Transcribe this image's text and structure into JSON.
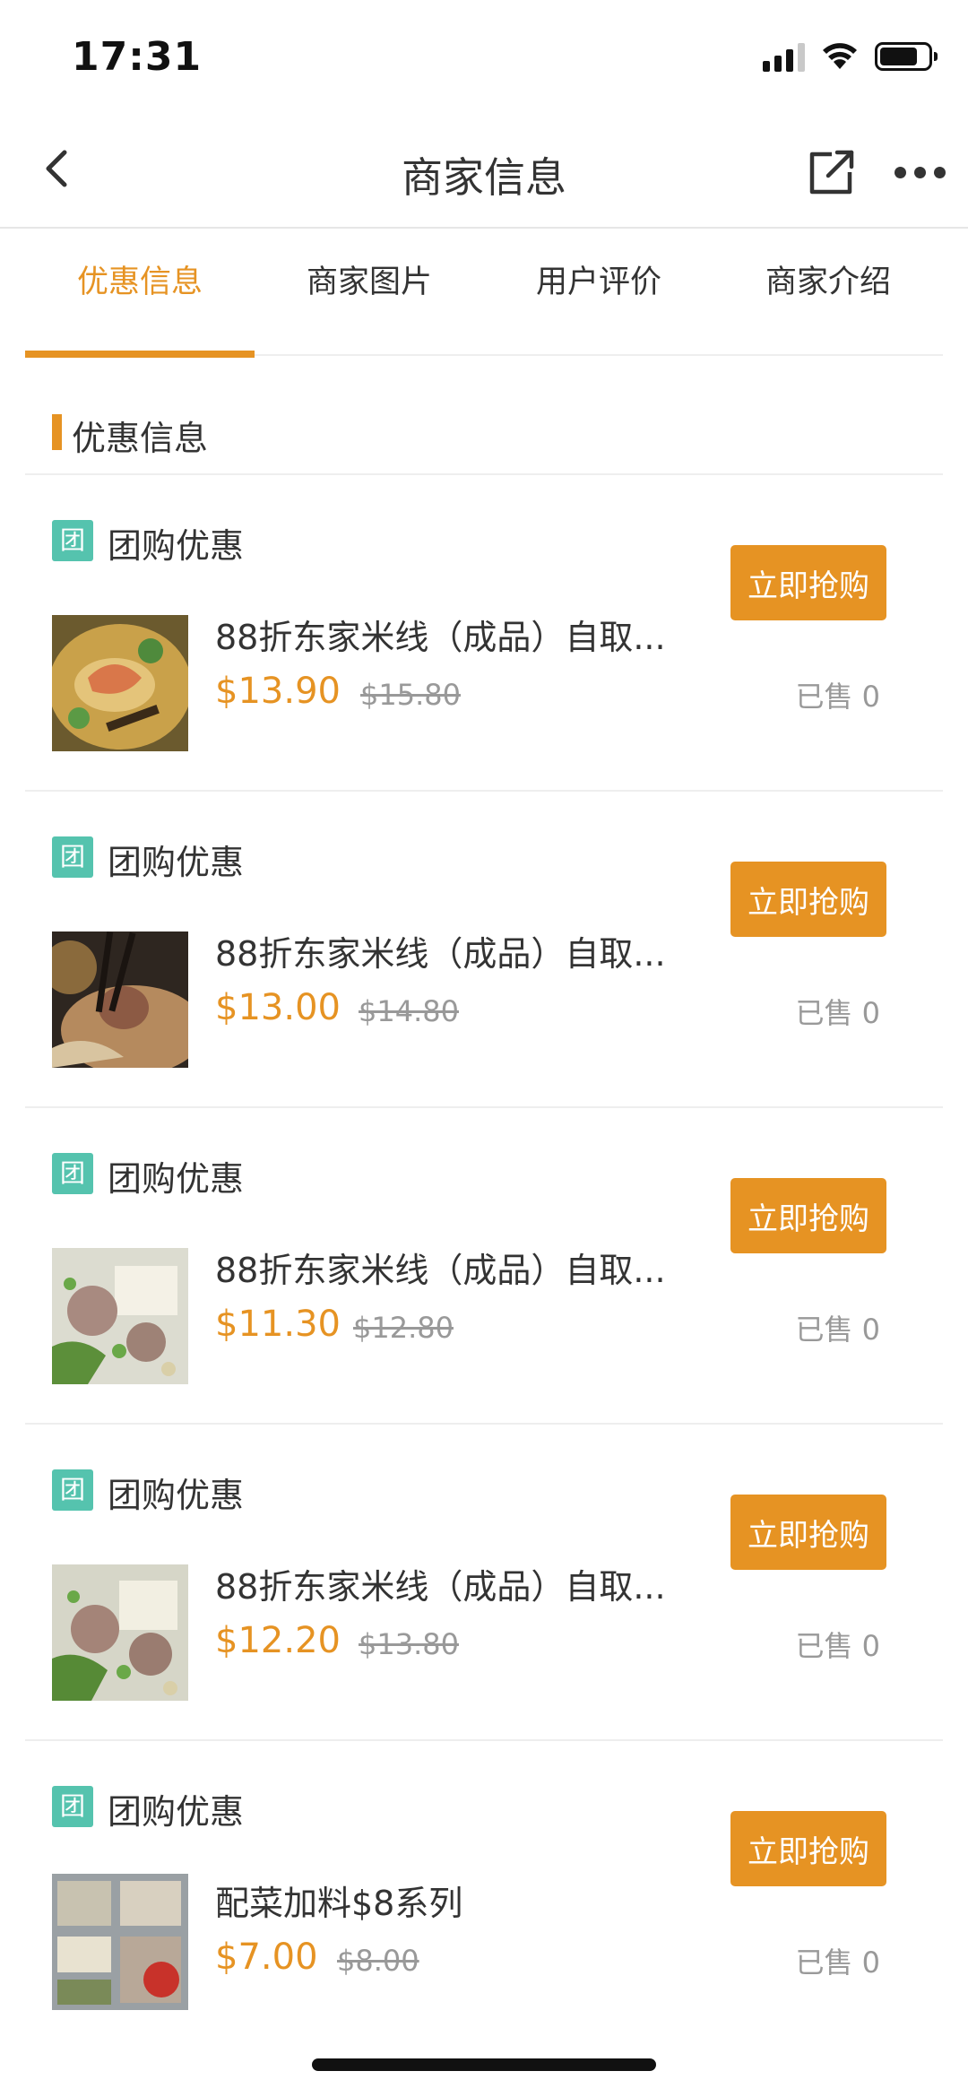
{
  "status_bar": {
    "time": "17:31"
  },
  "nav": {
    "title": "商家信息"
  },
  "tabs": [
    {
      "label": "优惠信息",
      "active": true
    },
    {
      "label": "商家图片",
      "active": false
    },
    {
      "label": "用户评价",
      "active": false
    },
    {
      "label": "商家介绍",
      "active": false
    }
  ],
  "section": {
    "title": "优惠信息"
  },
  "deals": [
    {
      "tag_icon": "团",
      "tag_label": "团购优惠",
      "name": "88折东家米线（成品）自取...",
      "price": "$13.90",
      "original_price": "$15.80",
      "buy_label": "立即抢购",
      "sold": "已售 0",
      "image": "food-photo-shrimp-hotpot"
    },
    {
      "tag_icon": "团",
      "tag_label": "团购优惠",
      "name": "88折东家米线（成品）自取...",
      "price": "$13.00",
      "original_price": "$14.80",
      "buy_label": "立即抢购",
      "sold": "已售 0",
      "image": "food-photo-chopsticks-noodles"
    },
    {
      "tag_icon": "团",
      "tag_label": "团购优惠",
      "name": "88折东家米线（成品）自取...",
      "price": "$11.30",
      "original_price": "$12.80",
      "buy_label": "立即抢购",
      "sold": "已售 0",
      "image": "food-photo-tofu-meatball-soup"
    },
    {
      "tag_icon": "团",
      "tag_label": "团购优惠",
      "name": "88折东家米线（成品）自取...",
      "price": "$12.20",
      "original_price": "$13.80",
      "buy_label": "立即抢购",
      "sold": "已售 0",
      "image": "food-photo-tofu-meatball-soup"
    },
    {
      "tag_icon": "团",
      "tag_label": "团购优惠",
      "name": "配菜加料$8系列",
      "price": "$7.00",
      "original_price": "$8.00",
      "buy_label": "立即抢购",
      "sold": "已售 0",
      "image": "food-photo-side-dishes"
    }
  ],
  "colors": {
    "accent": "#e69323",
    "tag": "#55c3ae",
    "divider": "#eeeeee",
    "muted": "#999999"
  }
}
